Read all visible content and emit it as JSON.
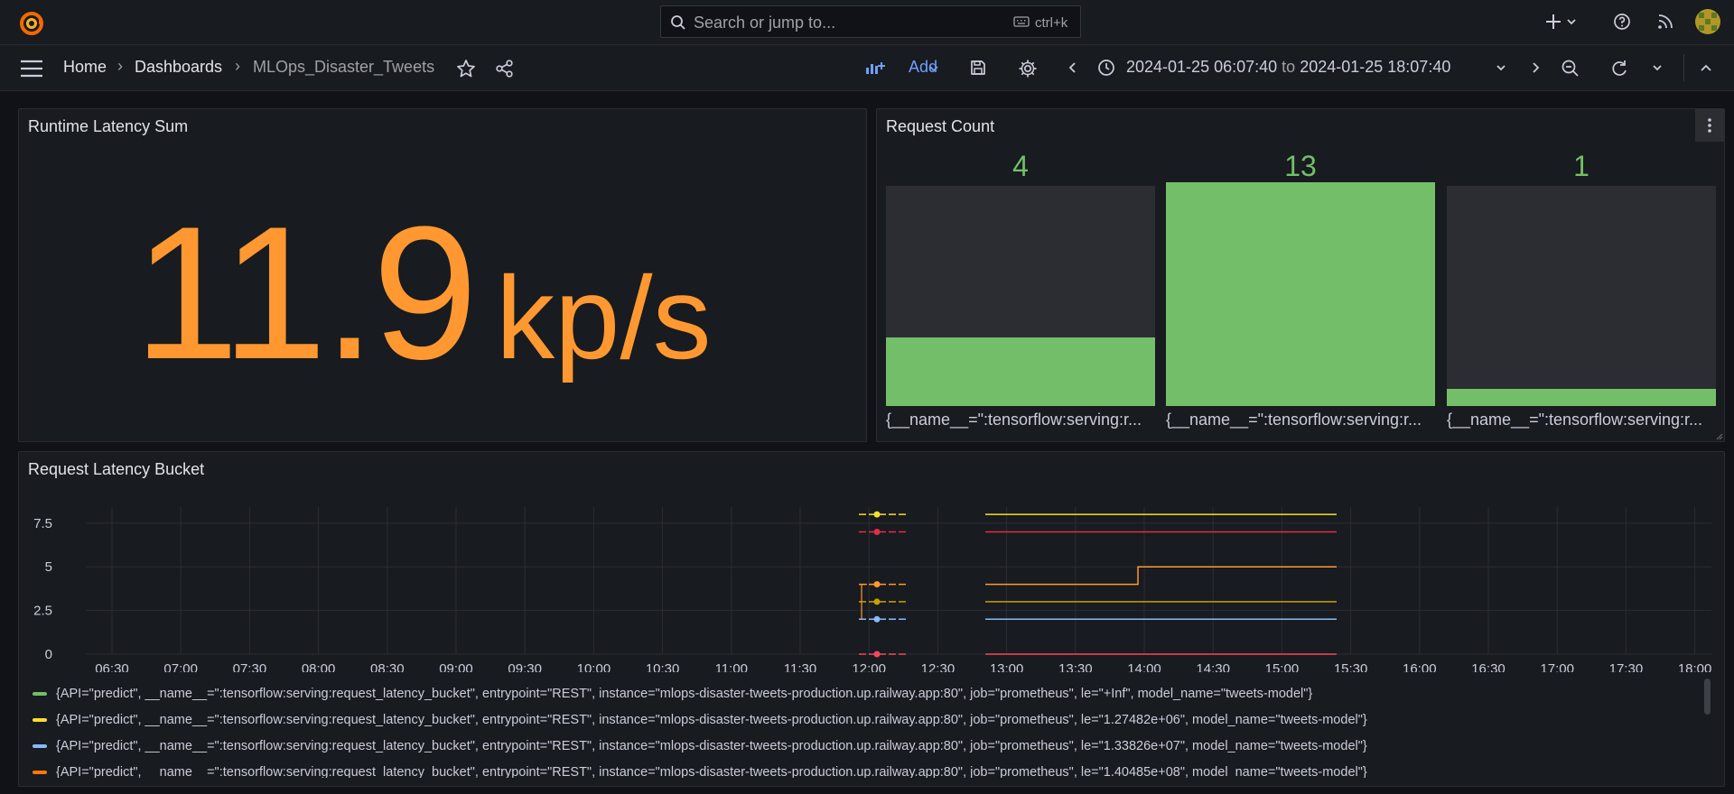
{
  "topbar": {
    "search_placeholder": "Search or jump to...",
    "search_shortcut": "ctrl+k",
    "icons": [
      "grafana-logo-icon",
      "search-icon",
      "keyboard-icon",
      "plus-icon",
      "chevron-down-icon",
      "help-icon",
      "rss-icon",
      "avatar"
    ]
  },
  "navbar": {
    "breadcrumbs": [
      "Home",
      "Dashboards",
      "MLOps_Disaster_Tweets"
    ],
    "add_label": "Add",
    "time_from": "2024-01-25 06:07:40",
    "time_to_word": "to",
    "time_to": "2024-01-25 18:07:40"
  },
  "panels": {
    "runtime": {
      "title": "Runtime Latency Sum",
      "value": "11.9",
      "unit": "kp/s",
      "color": "#ff9830"
    },
    "request_count": {
      "title": "Request Count",
      "color": "#73bf69",
      "bars": [
        {
          "value": "4",
          "label": "{__name__=\":tensorflow:serving:r..."
        },
        {
          "value": "13",
          "label": "{__name__=\":tensorflow:serving:r..."
        },
        {
          "value": "1",
          "label": "{__name__=\":tensorflow:serving:r..."
        }
      ]
    },
    "latency_bucket": {
      "title": "Request Latency Bucket"
    }
  },
  "chart_data": {
    "type": "line",
    "title": "Request Latency Bucket",
    "ylim": [
      0,
      8
    ],
    "y_ticks": [
      "0",
      "2.5",
      "5",
      "7.5"
    ],
    "x_ticks": [
      "06:30",
      "07:00",
      "07:30",
      "08:00",
      "08:30",
      "09:00",
      "09:30",
      "10:00",
      "10:30",
      "11:00",
      "11:30",
      "12:00",
      "12:30",
      "13:00",
      "13:30",
      "14:00",
      "14:30",
      "15:00",
      "15:30",
      "16:00",
      "16:30",
      "17:00",
      "17:30",
      "18:00"
    ],
    "grid": true,
    "legend_placement": "bottom",
    "series": [
      {
        "name": "{API=\"predict\", __name__=\":tensorflow:serving:request_latency_bucket\", entrypoint=\"REST\", instance=\"mlops-disaster-tweets-production.up.railway.app:80\", job=\"prometheus\", le=\"+Inf\", model_name=\"tweets-model\"}",
        "color": "#73bf69"
      },
      {
        "name": "{API=\"predict\", __name__=\":tensorflow:serving:request_latency_bucket\", entrypoint=\"REST\", instance=\"mlops-disaster-tweets-production.up.railway.app:80\", job=\"prometheus\", le=\"1.27482e+06\", model_name=\"tweets-model\"}",
        "color": "#fade2a"
      },
      {
        "name": "{API=\"predict\", __name__=\":tensorflow:serving:request_latency_bucket\", entrypoint=\"REST\", instance=\"mlops-disaster-tweets-production.up.railway.app:80\", job=\"prometheus\", le=\"1.33826e+07\", model_name=\"tweets-model\"}",
        "color": "#8ab8ff"
      },
      {
        "name": "{API=\"predict\", __name__=\":tensorflow:serving:request_latency_bucket\", entrypoint=\"REST\", instance=\"mlops-disaster-tweets-production.up.railway.app:80\", job=\"prometheus\", le=\"1.40485e+08\", model_name=\"tweets-model\"}",
        "color": "#ff780a"
      }
    ]
  }
}
